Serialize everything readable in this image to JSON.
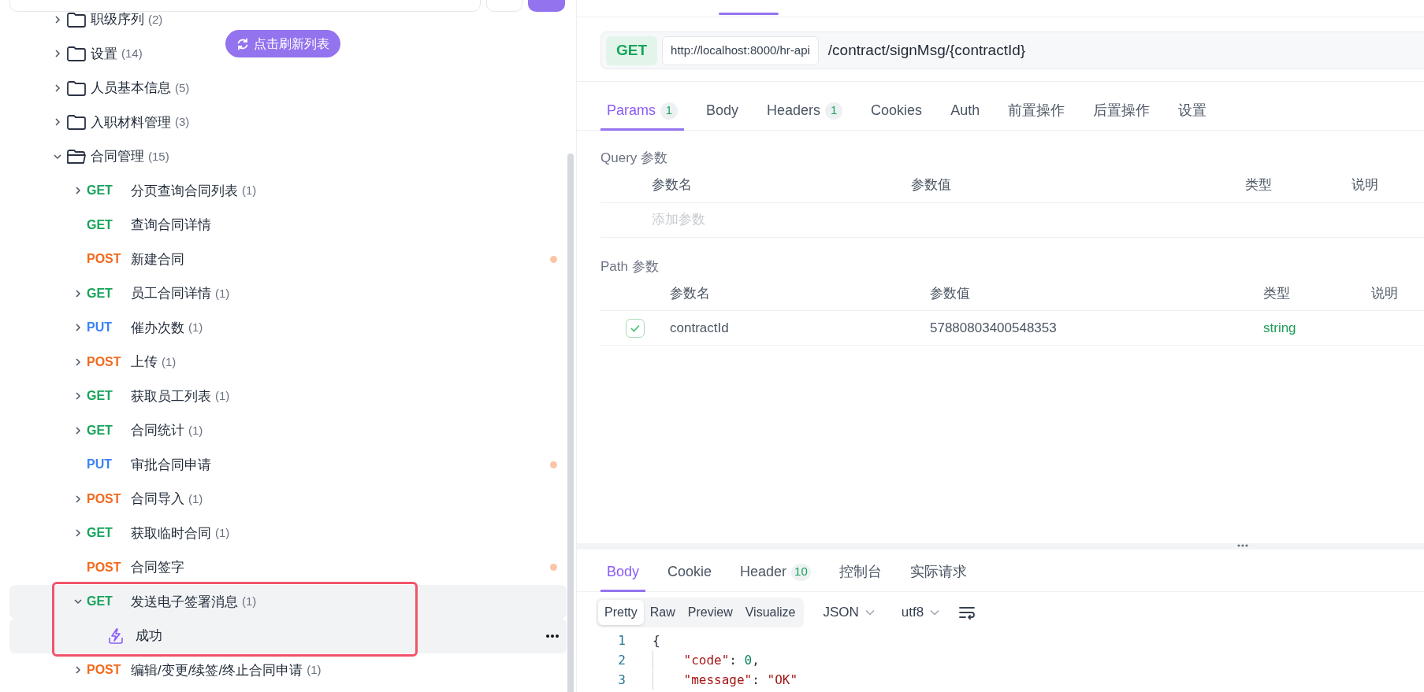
{
  "sidebar": {
    "refresh_button": {
      "label": "点击刷新列表"
    },
    "tree": [
      {
        "kind": "folder",
        "label": "职级序列",
        "count": "(2)",
        "expanded": false
      },
      {
        "kind": "folder",
        "label": "设置",
        "count": "(14)",
        "expanded": false
      },
      {
        "kind": "folder",
        "label": "人员基本信息",
        "count": "(5)",
        "expanded": false
      },
      {
        "kind": "folder",
        "label": "入职材料管理",
        "count": "(3)",
        "expanded": false
      },
      {
        "kind": "folder",
        "label": "合同管理",
        "count": "(15)",
        "expanded": true,
        "children": [
          {
            "kind": "request",
            "method": "GET",
            "label": "分页查询合同列表",
            "count": "(1)",
            "expandable": true,
            "expanded": false,
            "unsaved": false,
            "selected": false
          },
          {
            "kind": "request",
            "method": "GET",
            "label": "查询合同详情",
            "expandable": false,
            "expanded": false,
            "unsaved": false,
            "selected": false
          },
          {
            "kind": "request",
            "method": "POST",
            "label": "新建合同",
            "expandable": false,
            "expanded": false,
            "unsaved": true,
            "selected": false
          },
          {
            "kind": "request",
            "method": "GET",
            "label": "员工合同详情",
            "count": "(1)",
            "expandable": true,
            "expanded": false,
            "unsaved": false,
            "selected": false
          },
          {
            "kind": "request",
            "method": "PUT",
            "label": "催办次数",
            "count": "(1)",
            "expandable": true,
            "expanded": false,
            "unsaved": false,
            "selected": false
          },
          {
            "kind": "request",
            "method": "POST",
            "label": "上传",
            "count": "(1)",
            "expandable": true,
            "expanded": false,
            "unsaved": false,
            "selected": false
          },
          {
            "kind": "request",
            "method": "GET",
            "label": "获取员工列表",
            "count": "(1)",
            "expandable": true,
            "expanded": false,
            "unsaved": false,
            "selected": false
          },
          {
            "kind": "request",
            "method": "GET",
            "label": "合同统计",
            "count": "(1)",
            "expandable": true,
            "expanded": false,
            "unsaved": false,
            "selected": false
          },
          {
            "kind": "request",
            "method": "PUT",
            "label": "审批合同申请",
            "expandable": false,
            "expanded": false,
            "unsaved": true,
            "selected": false
          },
          {
            "kind": "request",
            "method": "POST",
            "label": "合同导入",
            "count": "(1)",
            "expandable": true,
            "expanded": false,
            "unsaved": false,
            "selected": false
          },
          {
            "kind": "request",
            "method": "GET",
            "label": "获取临时合同",
            "count": "(1)",
            "expandable": true,
            "expanded": false,
            "unsaved": false,
            "selected": false
          },
          {
            "kind": "request",
            "method": "POST",
            "label": "合同签字",
            "expandable": false,
            "expanded": false,
            "unsaved": true,
            "selected": false
          },
          {
            "kind": "request",
            "method": "GET",
            "label": "发送电子签署消息",
            "count": "(1)",
            "expandable": true,
            "expanded": true,
            "unsaved": false,
            "selected": true,
            "children": [
              {
                "kind": "example",
                "label": "成功",
                "selected": true,
                "hovered": true
              }
            ]
          },
          {
            "kind": "request",
            "method": "POST",
            "label": "编辑/变更/续签/终止合同申请",
            "count": "(1)",
            "expandable": true,
            "expanded": false,
            "unsaved": false,
            "selected": false
          }
        ]
      }
    ]
  },
  "url_bar": {
    "method": "GET",
    "base_url": "http://localhost:8000/hr-api",
    "path": "/contract/signMsg/{contractId}"
  },
  "request_tabs": [
    {
      "label": "Params",
      "count": "1",
      "selected": true
    },
    {
      "label": "Body",
      "selected": false
    },
    {
      "label": "Headers",
      "count": "1",
      "selected": false
    },
    {
      "label": "Cookies",
      "selected": false
    },
    {
      "label": "Auth",
      "selected": false
    },
    {
      "label": "前置操作",
      "selected": false
    },
    {
      "label": "后置操作",
      "selected": false
    },
    {
      "label": "设置",
      "selected": false
    }
  ],
  "query_params": {
    "title": "Query 参数",
    "columns": [
      "参数名",
      "参数值",
      "类型",
      "说明"
    ],
    "placeholder": "添加参数"
  },
  "path_params": {
    "title": "Path 参数",
    "columns": [
      "参数名",
      "参数值",
      "类型",
      "说明"
    ],
    "rows": [
      {
        "enabled": true,
        "name": "contractId",
        "value": "57880803400548353",
        "type": "string"
      }
    ]
  },
  "response": {
    "tabs": [
      {
        "label": "Body",
        "selected": true
      },
      {
        "label": "Cookie",
        "selected": false
      },
      {
        "label": "Header",
        "count": "10",
        "selected": false
      },
      {
        "label": "控制台",
        "selected": false
      },
      {
        "label": "实际请求",
        "selected": false
      }
    ],
    "view_modes": [
      {
        "label": "Pretty",
        "selected": true
      },
      {
        "label": "Raw",
        "selected": false
      },
      {
        "label": "Preview",
        "selected": false
      },
      {
        "label": "Visualize",
        "selected": false
      }
    ],
    "format": "JSON",
    "encoding": "utf8",
    "code_lines": [
      {
        "number": "1",
        "text": "{"
      },
      {
        "number": "2",
        "text": "    \"code\": 0,"
      },
      {
        "number": "3",
        "text": "    \"message\": \"OK\""
      }
    ]
  }
}
